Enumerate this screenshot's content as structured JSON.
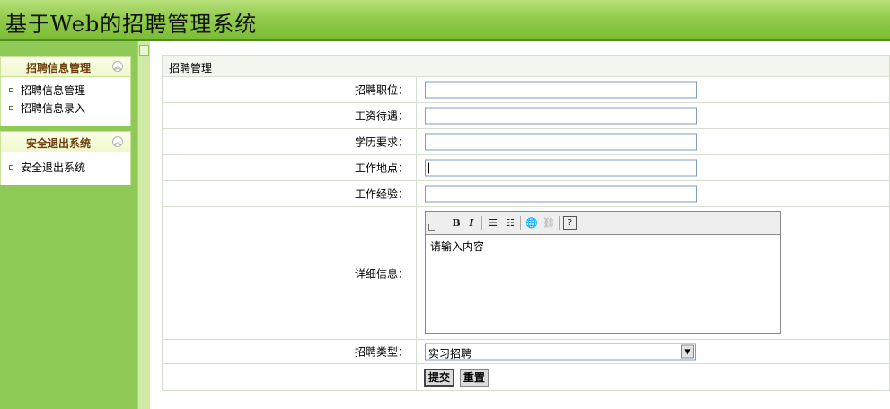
{
  "header": {
    "title": "基于Web的招聘管理系统"
  },
  "sidebar": {
    "panels": [
      {
        "title": "招聘信息管理",
        "items": [
          "招聘信息管理",
          "招聘信息录入"
        ]
      },
      {
        "title": "安全退出系统",
        "items": [
          "安全退出系统"
        ]
      }
    ]
  },
  "form": {
    "title": "招聘管理",
    "fields": [
      {
        "label": "招聘职位：",
        "value": ""
      },
      {
        "label": "工资待遇：",
        "value": ""
      },
      {
        "label": "学历要求：",
        "value": ""
      },
      {
        "label": "工作地点：",
        "value": ""
      },
      {
        "label": "工作经验：",
        "value": ""
      }
    ],
    "detail": {
      "label": "详细信息：",
      "placeholder": "请输入内容"
    },
    "type": {
      "label": "招聘类型：",
      "selected": "实习招聘"
    },
    "buttons": {
      "submit": "提交",
      "reset": "重置"
    }
  }
}
